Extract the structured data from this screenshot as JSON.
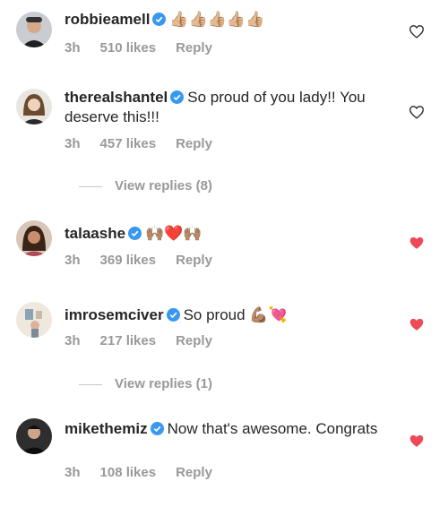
{
  "comments": [
    {
      "username": "robbieamell",
      "text": "",
      "emoji": "👍🏼👍🏼👍🏼👍🏼👍🏼",
      "time": "3h",
      "likes": "510 likes",
      "reply": "Reply",
      "liked": false
    },
    {
      "username": "therealshantel",
      "text": "So proud of you lady!! You deserve this!!!",
      "emoji": "",
      "time": "3h",
      "likes": "457 likes",
      "reply": "Reply",
      "liked": false,
      "view_replies": "View replies (8)"
    },
    {
      "username": "talaashe",
      "text": "",
      "emoji": "🙌🏽❤️🙌🏽",
      "time": "3h",
      "likes": "369 likes",
      "reply": "Reply",
      "liked": true
    },
    {
      "username": "imrosemciver",
      "text": "So proud",
      "emoji": "💪🏽💘",
      "time": "3h",
      "likes": "217 likes",
      "reply": "Reply",
      "liked": true,
      "view_replies": "View replies (1)"
    },
    {
      "username": "mikethemiz",
      "text": "Now that's awesome. Congrats",
      "emoji": "",
      "time": "3h",
      "likes": "108 likes",
      "reply": "Reply",
      "liked": true
    }
  ],
  "icons": {
    "verified": "verified-badge-icon",
    "heart_outline": "heart-outline-icon",
    "heart_filled": "heart-filled-icon"
  },
  "colors": {
    "verified_blue": "#3897f0",
    "heart_red": "#ed4956",
    "meta_gray": "#999999"
  }
}
